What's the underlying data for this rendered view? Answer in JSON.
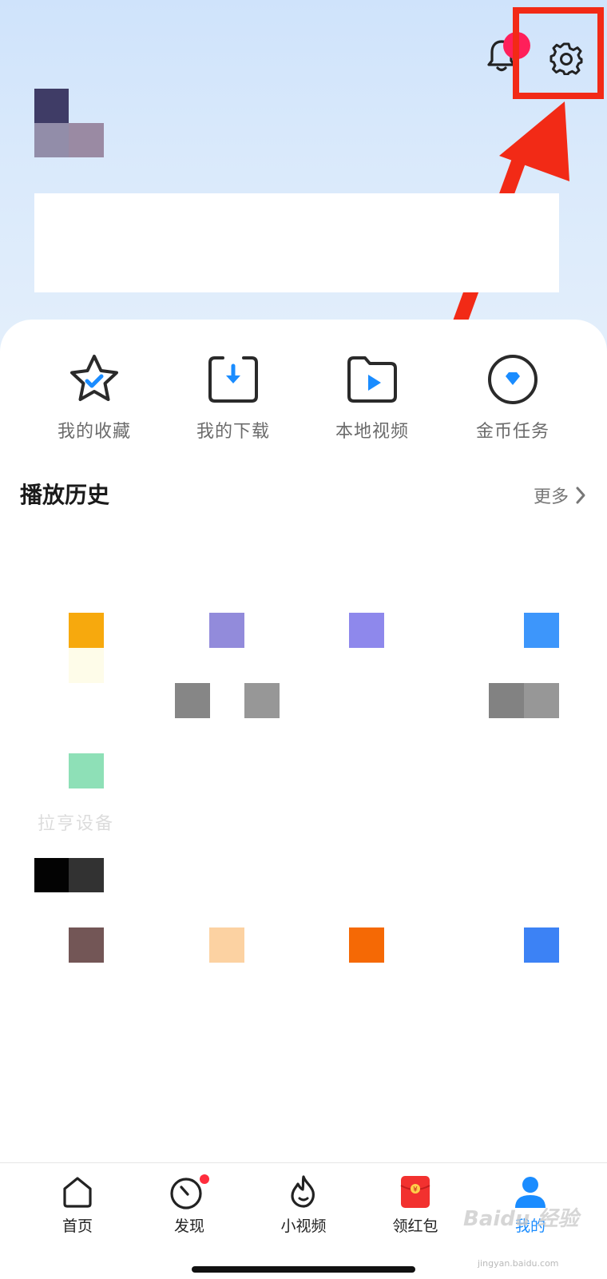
{
  "quick_actions": [
    {
      "label": "我的收藏",
      "icon": "star-check-icon"
    },
    {
      "label": "我的下载",
      "icon": "download-icon"
    },
    {
      "label": "本地视频",
      "icon": "folder-play-icon"
    },
    {
      "label": "金币任务",
      "icon": "coin-diamond-icon"
    }
  ],
  "history": {
    "title": "播放历史",
    "more_label": "更多"
  },
  "faded_section_label": "拉亨设备",
  "tabbar": [
    {
      "label": "首页",
      "icon": "home-icon",
      "active": false
    },
    {
      "label": "发现",
      "icon": "compass-icon",
      "active": false,
      "badge": true
    },
    {
      "label": "小视频",
      "icon": "flame-icon",
      "active": false
    },
    {
      "label": "领红包",
      "icon": "red-packet-icon",
      "active": false
    },
    {
      "label": "我的",
      "icon": "profile-icon",
      "active": true
    }
  ],
  "watermark": {
    "text": "Baidu 经验",
    "url_text": "jingyan.baidu.com"
  },
  "colors": {
    "accent_blue": "#1a8cff",
    "highlight_red": "#f22a16",
    "notification_dot": "#ff1f5a"
  }
}
